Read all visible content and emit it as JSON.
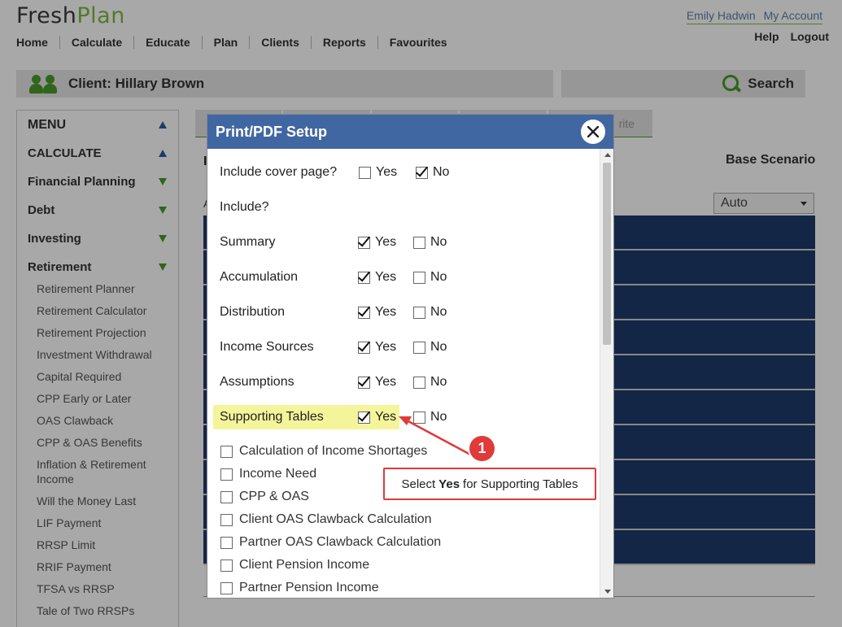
{
  "app": {
    "brand_part1": "Fresh",
    "brand_part2": "Plan",
    "user_name": "Emily Hadwin",
    "my_account": "My Account",
    "help": "Help",
    "logout": "Logout",
    "nav": [
      "Home",
      "Calculate",
      "Educate",
      "Plan",
      "Clients",
      "Reports",
      "Favourites"
    ]
  },
  "client_bar": {
    "label": "Client: Hillary Brown"
  },
  "search": {
    "label": "Search"
  },
  "sidebar": {
    "menu_title": "MENU",
    "calculate": "CALCULATE",
    "sections": [
      "Financial Planning",
      "Debt",
      "Investing",
      "Retirement"
    ],
    "retirement_items": [
      "Retirement Planner",
      "Retirement Calculator",
      "Retirement Projection",
      "Investment Withdrawal",
      "Capital Required",
      "CPP Early or Later",
      "OAS Clawback",
      "CPP & OAS Benefits",
      "Inflation & Retirement Income",
      "Will the Money Last",
      "LIF Payment",
      "RRSP Limit",
      "RRIF Payment",
      "TFSA vs RRSP",
      "Tale of Two RRSPs"
    ]
  },
  "background": {
    "tab_favourite": "rite",
    "scenario_label": "Base Scenario",
    "select_value": "Auto",
    "peek_heading": "I",
    "peek_label": "A"
  },
  "modal": {
    "title": "Print/PDF Setup",
    "yes": "Yes",
    "no": "No",
    "include_heading": "Include?",
    "options": [
      {
        "label": "Include cover page?",
        "yes": false,
        "no": true
      },
      {
        "label": "Summary",
        "yes": true,
        "no": false
      },
      {
        "label": "Accumulation",
        "yes": true,
        "no": false
      },
      {
        "label": "Distribution",
        "yes": true,
        "no": false
      },
      {
        "label": "Income Sources",
        "yes": true,
        "no": false
      },
      {
        "label": "Assumptions",
        "yes": true,
        "no": false
      },
      {
        "label": "Supporting Tables",
        "yes": true,
        "no": false
      }
    ],
    "supporting_tables": [
      "Calculation of Income Shortages",
      "Income Need",
      "CPP & OAS",
      "Client OAS Clawback Calculation",
      "Partner OAS Clawback Calculation",
      "Client Pension Income",
      "Partner Pension Income"
    ]
  },
  "annotation": {
    "number": "1",
    "text_before": "Select",
    "text_bold": "Yes",
    "text_after": "for Supporting Tables",
    "color": "#e03a3a"
  },
  "colors": {
    "header_blue": "#4167a2",
    "brand_green": "#7dbb3c",
    "highlight_yellow": "#f4f59a",
    "row_navy": "#1e3a6b"
  }
}
